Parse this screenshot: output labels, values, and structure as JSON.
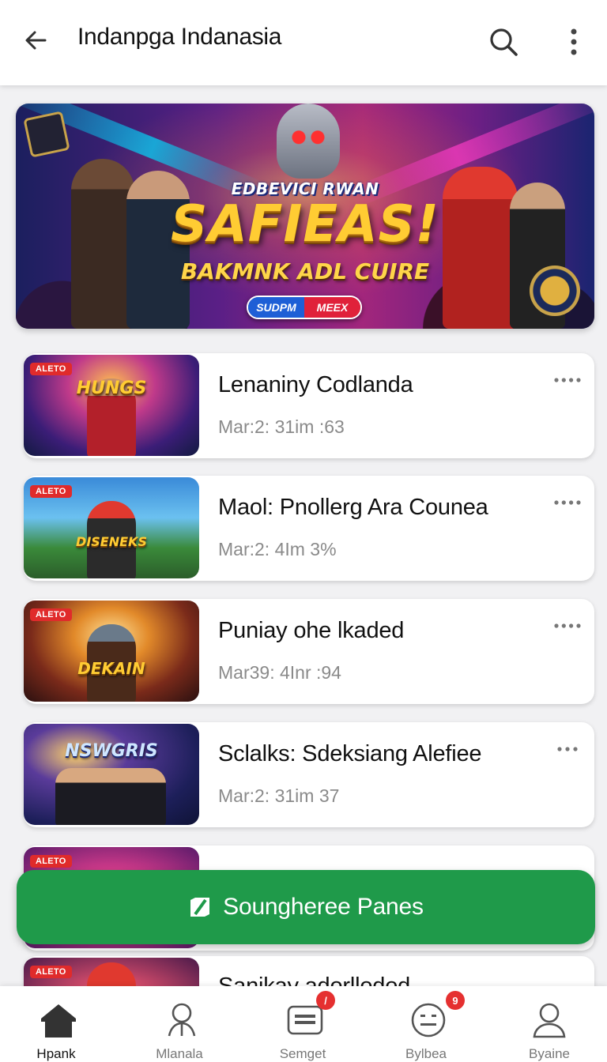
{
  "header": {
    "title": "Indanpga Indanasia",
    "back_icon": "arrow-left-icon",
    "search_icon": "search-icon",
    "more_icon": "more-vertical-icon"
  },
  "hero": {
    "subtitle": "EDBEVICI RWAN",
    "title": "SAFIEAS!",
    "tagline": "BAKMNK ADL CUIRE",
    "pill_left": "SUDPM",
    "pill_right": "MEEX"
  },
  "items": [
    {
      "badge": "ALETO",
      "thumb_title": "HUNGS",
      "title": "Lenaniny Codlanda",
      "meta": "Mar:2: 31im :63"
    },
    {
      "badge": "ALETO",
      "thumb_title": "DISENEKS",
      "title": "Maol: Pnollerg Ara Counea",
      "meta": "Mar:2: 4Im 3%"
    },
    {
      "badge": "ALETO",
      "thumb_title": "DEKAIN",
      "title": "Puniay ohe lkaded",
      "meta": "Mar39: 4Inr :94"
    },
    {
      "badge": "",
      "thumb_title": "NSWGRIS",
      "title": "Sclalks: Sdeksiang Alefiee",
      "meta": "Mar:2: 31im 37"
    },
    {
      "badge": "ALETO",
      "thumb_title": "",
      "title": "",
      "meta": ""
    },
    {
      "badge": "ALETO",
      "thumb_title": "",
      "title": "Sanikay adorllodod",
      "meta": ""
    }
  ],
  "fab": {
    "label": "Soungheree Panes",
    "icon": "slash-box-icon",
    "color": "#1f9a4a"
  },
  "bottom_nav": [
    {
      "label": "Hpank",
      "icon": "home-icon",
      "active": true,
      "badge": ""
    },
    {
      "label": "Mlanala",
      "icon": "user-pin-icon",
      "active": false,
      "badge": ""
    },
    {
      "label": "Semget",
      "icon": "message-icon",
      "active": false,
      "badge": "/"
    },
    {
      "label": "Bylbea",
      "icon": "face-icon",
      "active": false,
      "badge": "9"
    },
    {
      "label": "Byaine",
      "icon": "profile-icon",
      "active": false,
      "badge": ""
    }
  ],
  "colors": {
    "accent_green": "#1f9a4a",
    "badge_red": "#e02b2b",
    "meta_gray": "#8a8a8a"
  }
}
